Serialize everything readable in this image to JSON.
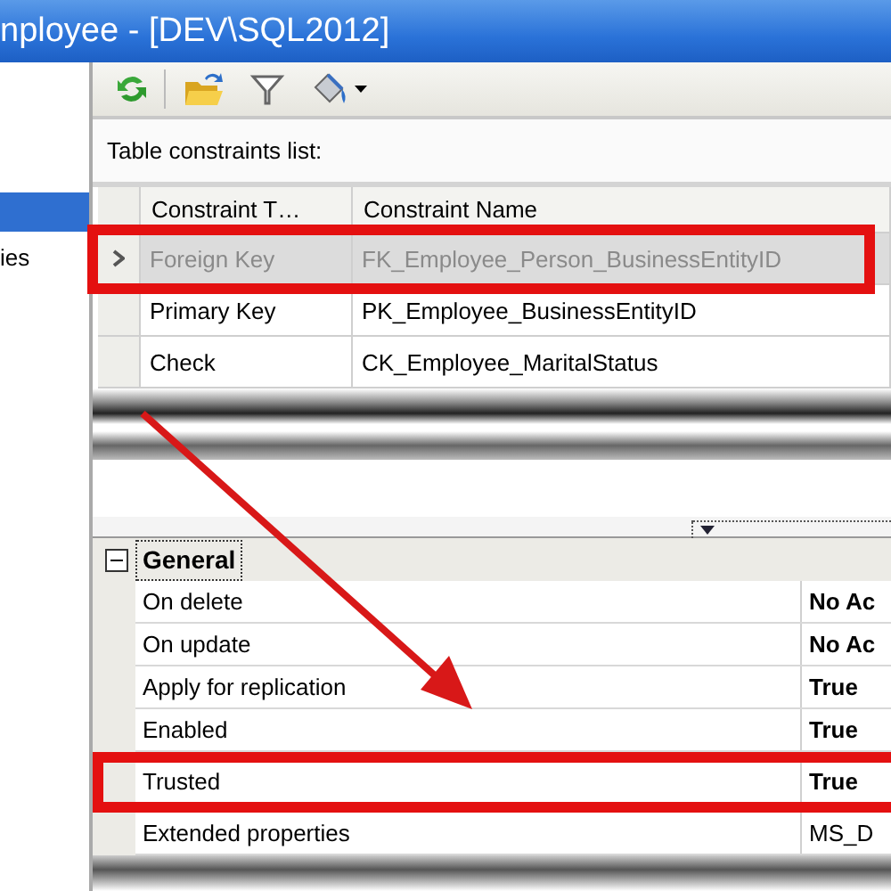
{
  "window": {
    "title": "nployee - [DEV\\SQL2012]"
  },
  "sidebar": {
    "items": [
      {
        "selected": true
      },
      {
        "label": "ies",
        "selected": false
      }
    ]
  },
  "toolbar": {
    "buttons": [
      {
        "kind": "refresh"
      },
      {
        "kind": "open"
      },
      {
        "kind": "filter"
      },
      {
        "kind": "fill",
        "dropdown": true
      }
    ]
  },
  "constraints": {
    "label": "Table constraints list:",
    "columns": [
      "Constraint T…",
      "Constraint Name"
    ],
    "rows": [
      {
        "type": "Foreign Key",
        "name": "FK_Employee_Person_BusinessEntityID",
        "selected": true
      },
      {
        "type": "Primary Key",
        "name": "PK_Employee_BusinessEntityID",
        "selected": false
      },
      {
        "type": "Check",
        "name": "CK_Employee_MaritalStatus",
        "selected": false
      }
    ]
  },
  "properties": {
    "category": "General",
    "expanded": true,
    "rows": [
      {
        "name": "On delete",
        "value": "No Ac",
        "bold": true
      },
      {
        "name": "On update",
        "value": "No Ac",
        "bold": true
      },
      {
        "name": "Apply for replication",
        "value": "True",
        "bold": true
      },
      {
        "name": "Enabled",
        "value": "True",
        "bold": true
      },
      {
        "name": "Trusted",
        "value": "True",
        "bold": true
      },
      {
        "name": "Extended properties",
        "value": "MS_D",
        "bold": false
      }
    ]
  }
}
